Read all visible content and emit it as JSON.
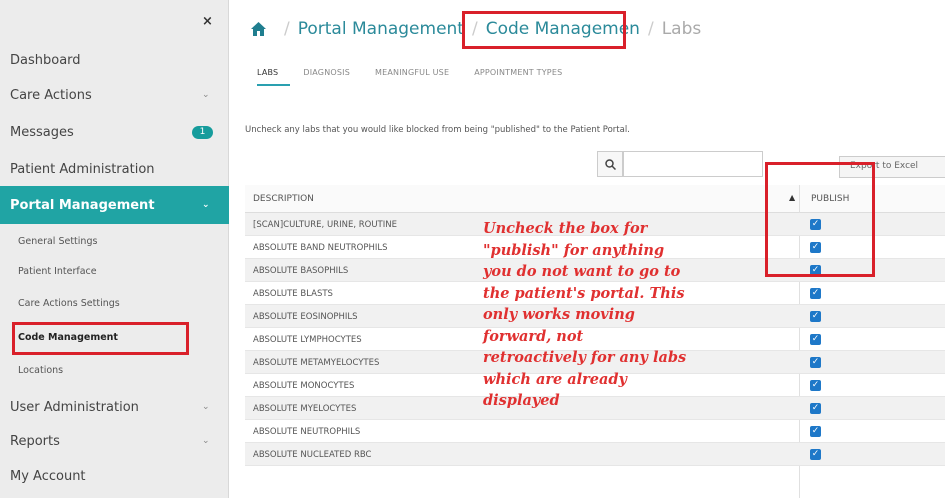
{
  "sidebar": {
    "close_glyph": "×",
    "items": [
      {
        "label": "Dashboard"
      },
      {
        "label": "Care Actions",
        "chevron": "⌄"
      },
      {
        "label": "Messages",
        "badge": "1"
      },
      {
        "label": "Patient Administration"
      },
      {
        "label": "Portal Management",
        "chevron": "⌄"
      }
    ],
    "sub_items": [
      {
        "label": "General Settings"
      },
      {
        "label": "Patient Interface"
      },
      {
        "label": "Care Actions Settings"
      },
      {
        "label": "Code Management"
      },
      {
        "label": "Locations"
      }
    ],
    "bottom_items": [
      {
        "label": "User Administration",
        "chevron": "⌄"
      },
      {
        "label": "Reports",
        "chevron": "⌄"
      },
      {
        "label": "My Account"
      }
    ]
  },
  "breadcrumb": {
    "home_icon": "home-icon",
    "items": [
      "Portal Management",
      "Code Managemen",
      "Labs"
    ]
  },
  "tabs": [
    "LABS",
    "DIAGNOSIS",
    "MEANINGFUL USE",
    "APPOINTMENT TYPES"
  ],
  "instructions": "Uncheck any labs that you would like blocked from being \"published\" to the Patient Portal.",
  "search": {
    "placeholder": ""
  },
  "export_label": "Export to Excel",
  "table": {
    "columns": [
      "DESCRIPTION",
      "PUBLISH"
    ],
    "sort_glyph": "▲",
    "rows": [
      {
        "description": "[SCAN]CULTURE, URINE, ROUTINE",
        "publish": true
      },
      {
        "description": "ABSOLUTE BAND NEUTROPHILS",
        "publish": true
      },
      {
        "description": "ABSOLUTE BASOPHILS",
        "publish": true
      },
      {
        "description": "ABSOLUTE BLASTS",
        "publish": true
      },
      {
        "description": "ABSOLUTE EOSINOPHILS",
        "publish": true
      },
      {
        "description": "ABSOLUTE LYMPHOCYTES",
        "publish": true
      },
      {
        "description": "ABSOLUTE METAMYELOCYTES",
        "publish": true
      },
      {
        "description": "ABSOLUTE MONOCYTES",
        "publish": true
      },
      {
        "description": "ABSOLUTE MYELOCYTES",
        "publish": true
      },
      {
        "description": "ABSOLUTE NEUTROPHILS",
        "publish": true
      },
      {
        "description": "ABSOLUTE NUCLEATED RBC",
        "publish": true
      }
    ]
  },
  "annotation": {
    "lines": [
      "Uncheck the box for",
      "\"publish\" for anything",
      "you do not want to go to",
      "the patient's portal. This",
      "only works moving",
      "forward, not",
      "retroactively for any labs",
      "which are already",
      "displayed"
    ]
  },
  "colors": {
    "accent": "#20a4a4",
    "highlight": "#d9202a",
    "annotation": "#e03030",
    "checkbox": "#1e78c8"
  }
}
